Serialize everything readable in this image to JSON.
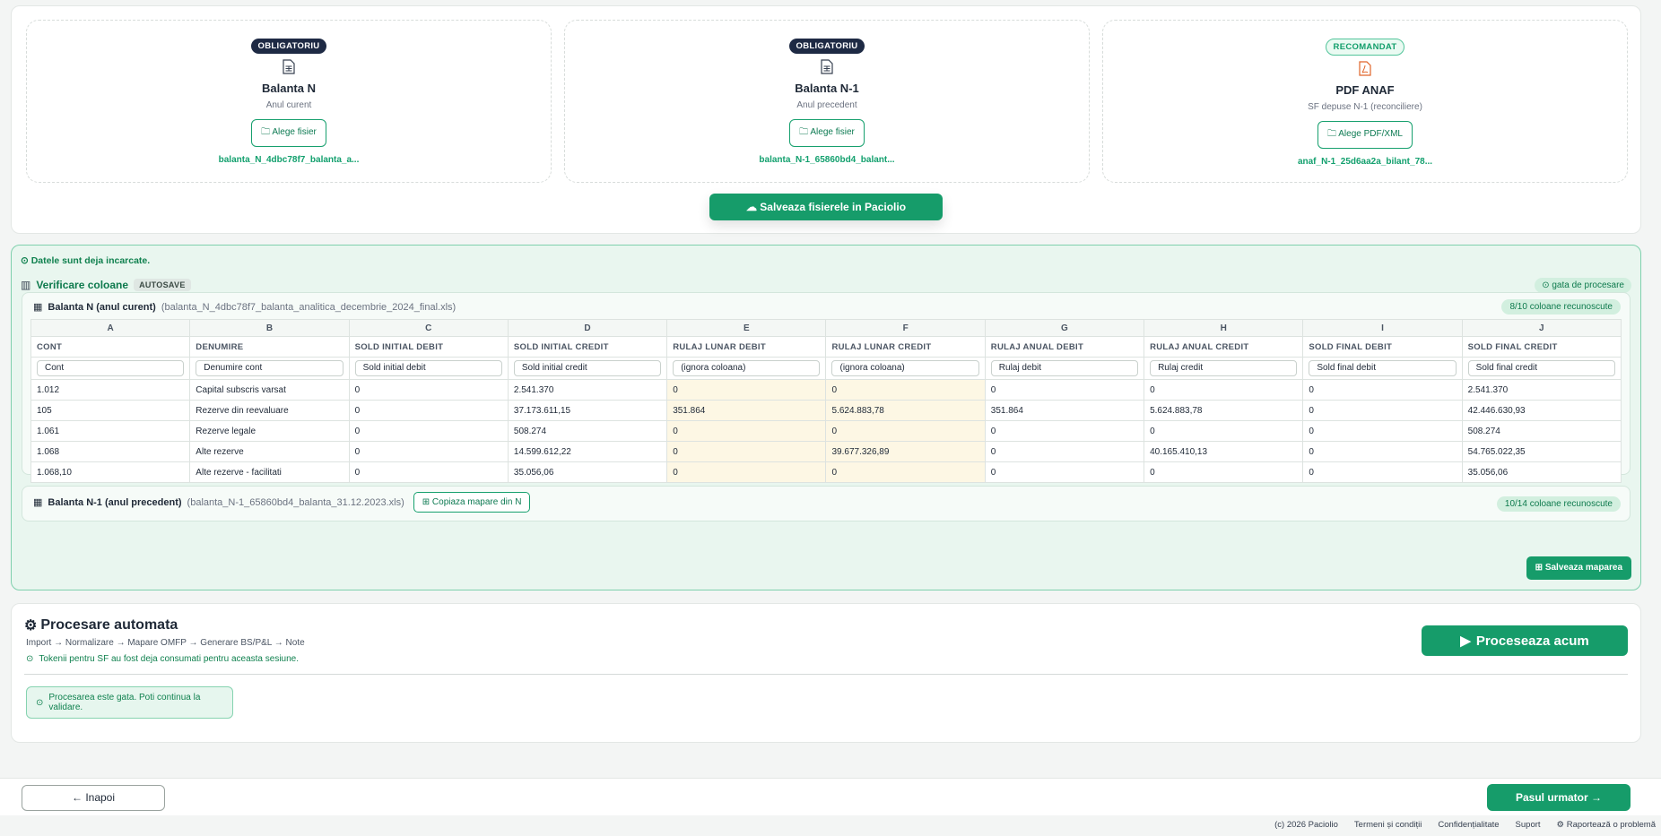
{
  "upload": {
    "slots": [
      {
        "badge": "OBLIGATORIU",
        "title": "Balanta N",
        "subtitle": "Anul curent",
        "button": "Alege fisier",
        "filename": "balanta_N_4dbc78f7_balanta_a..."
      },
      {
        "badge": "OBLIGATORIU",
        "title": "Balanta N-1",
        "subtitle": "Anul precedent",
        "button": "Alege fisier",
        "filename": "balanta_N-1_65860bd4_balant..."
      },
      {
        "badge": "RECOMANDAT",
        "title": "PDF ANAF",
        "subtitle": "SF depuse N-1 (reconciliere)",
        "button": "Alege PDF/XML",
        "filename": "anaf_N-1_25d6aa2a_bilant_78..."
      }
    ],
    "save_button": "Salveaza fisierele in Paciolio"
  },
  "verify": {
    "loaded_msg": "Datele sunt deja incarcate.",
    "title": "Verificare coloane",
    "autosave": "AUTOSAVE",
    "ready": "gata de procesare",
    "panel_n": {
      "title": "Balanta N (anul curent)",
      "file": "(balanta_N_4dbc78f7_balanta_analitica_decembrie_2024_final.xls)",
      "recognized": "8/10 coloane recunoscute",
      "letters": [
        "A",
        "B",
        "C",
        "D",
        "E",
        "F",
        "G",
        "H",
        "I",
        "J"
      ],
      "headers": [
        "CONT",
        "DENUMIRE",
        "SOLD INITIAL DEBIT",
        "SOLD INITIAL CREDIT",
        "RULAJ LUNAR DEBIT",
        "RULAJ LUNAR CREDIT",
        "RULAJ ANUAL DEBIT",
        "RULAJ ANUAL CREDIT",
        "SOLD FINAL DEBIT",
        "SOLD FINAL CREDIT"
      ],
      "mappings": [
        "Cont",
        "Denumire cont",
        "Sold initial debit",
        "Sold initial credit",
        "(ignora coloana)",
        "(ignora coloana)",
        "Rulaj debit",
        "Rulaj credit",
        "Sold final debit",
        "Sold final credit"
      ],
      "rows": [
        [
          "1.012",
          "Capital subscris varsat",
          "0",
          "2.541.370",
          "0",
          "0",
          "0",
          "0",
          "0",
          "2.541.370"
        ],
        [
          "105",
          "Rezerve din reevaluare",
          "0",
          "37.173.611,15",
          "351.864",
          "5.624.883,78",
          "351.864",
          "5.624.883,78",
          "0",
          "42.446.630,93"
        ],
        [
          "1.061",
          "Rezerve legale",
          "0",
          "508.274",
          "0",
          "0",
          "0",
          "0",
          "0",
          "508.274"
        ],
        [
          "1.068",
          "Alte rezerve",
          "0",
          "14.599.612,22",
          "0",
          "39.677.326,89",
          "0",
          "40.165.410,13",
          "0",
          "54.765.022,35"
        ],
        [
          "1.068,10",
          "Alte rezerve - facilitati",
          "0",
          "35.056,06",
          "0",
          "0",
          "0",
          "0",
          "0",
          "35.056,06"
        ]
      ]
    },
    "panel_n1": {
      "title": "Balanta N-1 (anul precedent)",
      "file": "(balanta_N-1_65860bd4_balanta_31.12.2023.xls)",
      "copy_button": "Copiaza mapare din N",
      "recognized": "10/14 coloane recunoscute"
    },
    "save_mapping": "Salveaza maparea"
  },
  "processing": {
    "title": "Procesare automata",
    "flow": "Import → Normalizare → Mapare OMFP → Generare BS/P&L → Note",
    "tokens_msg": "Tokenii pentru SF au fost deja consumati pentru aceasta sesiune.",
    "done_msg": "Procesarea este gata. Poti continua la validare.",
    "run_button": "Proceseaza acum"
  },
  "nav": {
    "back": "← Inapoi",
    "next": "Pasul urmator →"
  },
  "footer": {
    "copyright": "(c) 2026 Paciolio",
    "terms": "Termeni și condiții",
    "privacy": "Confidențialitate",
    "support": "Suport",
    "report": "Raportează o problemă"
  }
}
